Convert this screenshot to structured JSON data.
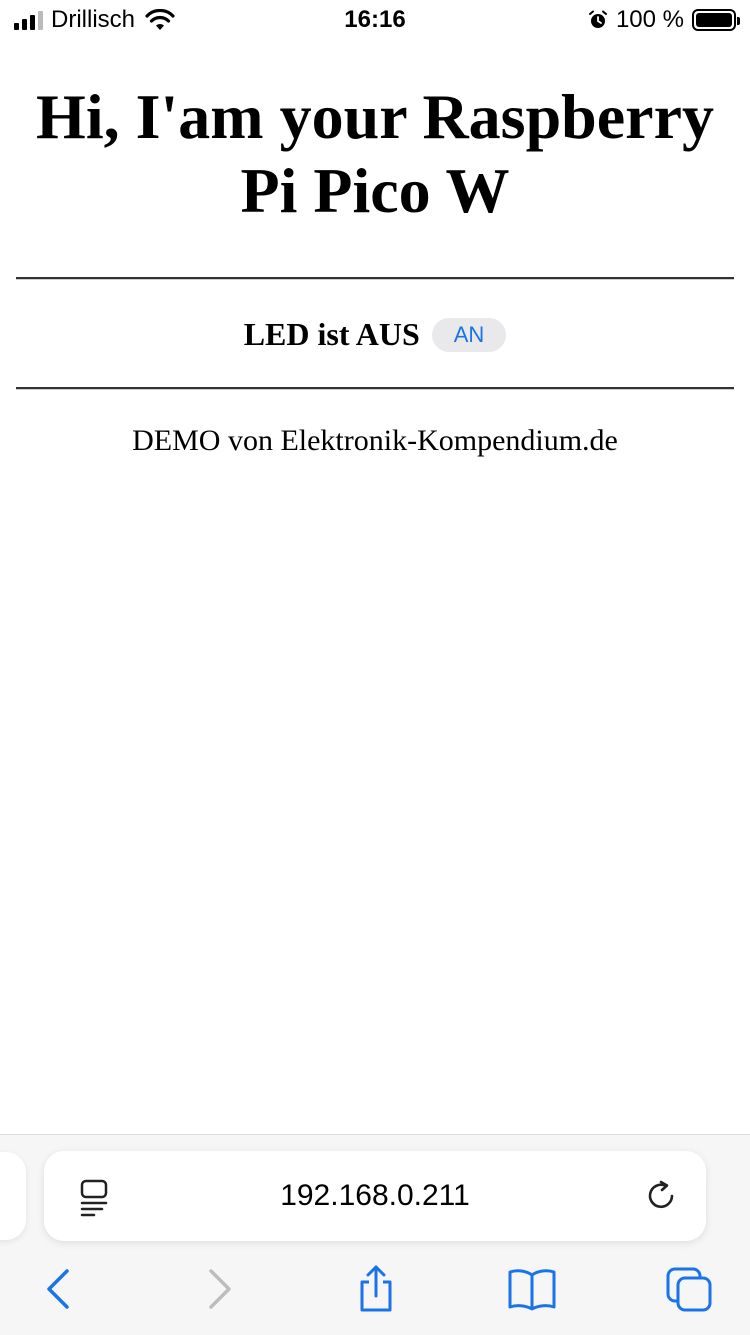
{
  "status_bar": {
    "carrier": "Drillisch",
    "time": "16:16",
    "battery": "100 %"
  },
  "page": {
    "title": "Hi, I'am your Raspberry Pi Pico W",
    "led_status": "LED ist AUS",
    "toggle_button": "AN",
    "footer": "DEMO von Elektronik-Kompendium.de"
  },
  "browser": {
    "url": "192.168.0.211"
  },
  "colors": {
    "accent": "#1a73e8",
    "button_bg": "#e9e9eb"
  },
  "icons": [
    "signal-icon",
    "wifi-icon",
    "alarm-icon",
    "battery-icon",
    "page-menu-icon",
    "reload-icon",
    "back-icon",
    "forward-icon",
    "share-icon",
    "bookmarks-icon",
    "tabs-icon"
  ]
}
